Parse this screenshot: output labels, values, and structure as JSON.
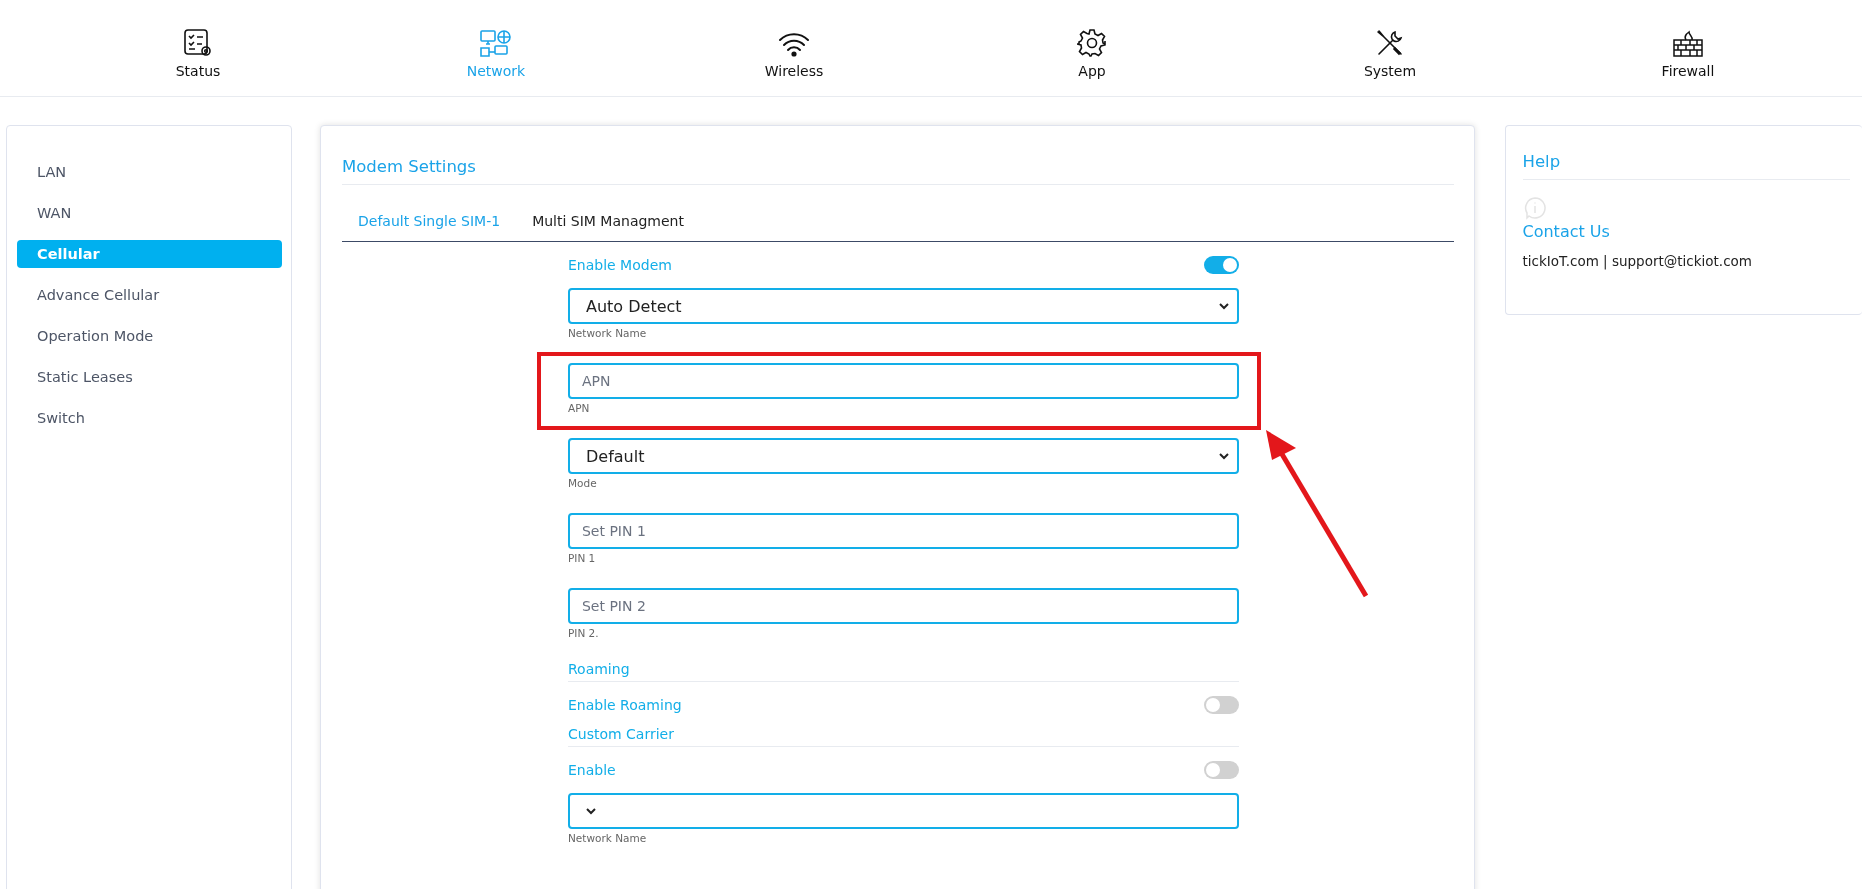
{
  "nav": [
    {
      "label": "Status",
      "selected": false
    },
    {
      "label": "Network",
      "selected": true
    },
    {
      "label": "Wireless",
      "selected": false
    },
    {
      "label": "App",
      "selected": false
    },
    {
      "label": "System",
      "selected": false
    },
    {
      "label": "Firewall",
      "selected": false
    }
  ],
  "sidebar": {
    "items": [
      {
        "label": "LAN",
        "selected": false
      },
      {
        "label": "WAN",
        "selected": false
      },
      {
        "label": "Cellular",
        "selected": true
      },
      {
        "label": "Advance Cellular",
        "selected": false
      },
      {
        "label": "Operation Mode",
        "selected": false
      },
      {
        "label": "Static Leases",
        "selected": false
      },
      {
        "label": "Switch",
        "selected": false
      }
    ]
  },
  "main": {
    "title": "Modem Settings",
    "tabs": [
      {
        "label": "Default Single SIM-1",
        "selected": true
      },
      {
        "label": "Multi SIM Managment",
        "selected": false
      }
    ],
    "form": [
      {
        "kind": "toggle",
        "label": "Enable Modem",
        "on": true
      },
      {
        "kind": "select",
        "value": "Auto Detect",
        "caption": "Network Name"
      },
      {
        "kind": "input",
        "placeholder": "APN",
        "caption": "APN"
      },
      {
        "kind": "select",
        "value": "Default",
        "caption": "Mode"
      },
      {
        "kind": "input",
        "placeholder": "Set PIN 1",
        "caption": "PIN 1"
      },
      {
        "kind": "input",
        "placeholder": "Set PIN 2",
        "caption": "PIN 2."
      },
      {
        "kind": "heading",
        "text": "Roaming"
      },
      {
        "kind": "toggle",
        "label": "Enable Roaming",
        "on": false
      },
      {
        "kind": "heading",
        "text": "Custom Carrier"
      },
      {
        "kind": "toggle",
        "label": "Enable",
        "on": false
      },
      {
        "kind": "select",
        "caption": "Network Name"
      }
    ]
  },
  "help": {
    "title": "Help",
    "contact_title": "Contact Us",
    "contact_text": "tickIoT.com | support@tickiot.com"
  }
}
